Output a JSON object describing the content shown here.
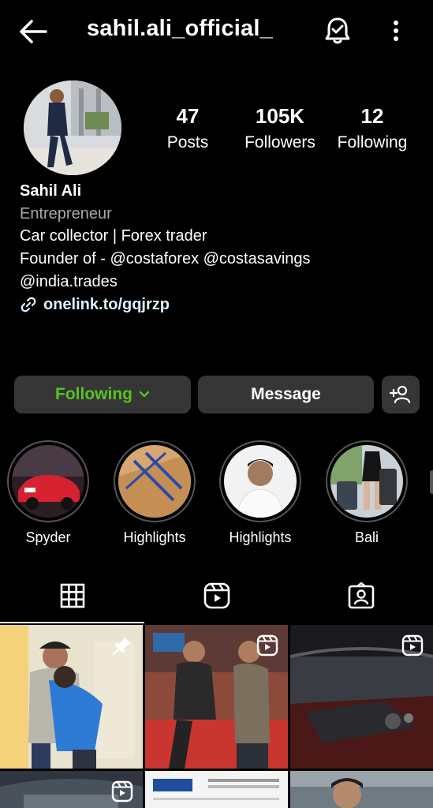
{
  "header": {
    "username": "sahil.ali_official_",
    "back_icon": "arrow-left-icon",
    "notifications_icon": "bell-check-icon",
    "more_icon": "more-vertical-icon"
  },
  "stats": {
    "posts": {
      "value": "47",
      "label": "Posts"
    },
    "followers": {
      "value": "105K",
      "label": "Followers"
    },
    "following": {
      "value": "12",
      "label": "Following"
    }
  },
  "bio": {
    "name": "Sahil Ali",
    "category": "Entrepreneur",
    "lines": [
      "Car collector | Forex trader",
      "Founder of - @costaforex @costasavings",
      "@india.trades"
    ],
    "link": "onelink.to/gqjrzp"
  },
  "actions": {
    "following_label": "Following",
    "message_label": "Message",
    "add_user_icon": "person-add-icon"
  },
  "highlights": [
    {
      "label": "Spyder"
    },
    {
      "label": "Highlights"
    },
    {
      "label": "Highlights"
    },
    {
      "label": "Bali"
    }
  ],
  "tabs": [
    {
      "icon": "grid-icon",
      "active": true
    },
    {
      "icon": "reels-icon",
      "active": false
    },
    {
      "icon": "tagged-icon",
      "active": false
    }
  ],
  "grid_badges": {
    "pinned_icon": "pin-icon",
    "reel_icon": "reels-icon"
  },
  "colors": {
    "background": "#000000",
    "button": "#363636",
    "following_green": "#58c322",
    "secondary_text": "#a8a8a8",
    "link": "#e0f1ff"
  }
}
